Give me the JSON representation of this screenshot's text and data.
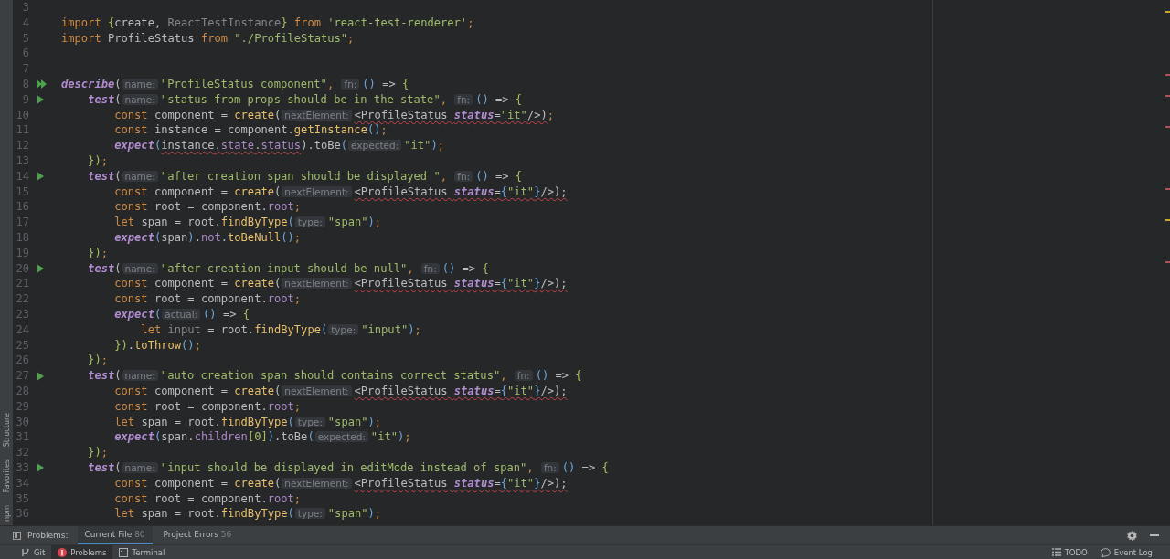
{
  "left_strip": [
    "Structure",
    "Favorites",
    "npm"
  ],
  "editor": {
    "lines": [
      {
        "number": "3",
        "kind": "plain"
      },
      {
        "number": "4",
        "kind": "plain",
        "tokens": [
          {
            "text": "import ",
            "kind": "kw"
          },
          {
            "text": "{",
            "kind": "brace"
          },
          {
            "text": "create, ",
            "kind": "plain"
          },
          {
            "text": "ReactTestInstance",
            "kind": "dim"
          },
          {
            "text": "}",
            "kind": "brace"
          },
          {
            "text": " from ",
            "kind": "kw"
          },
          {
            "text": "'react-test-renderer'",
            "kind": "str"
          },
          {
            "text": ";",
            "kind": "kw"
          }
        ]
      },
      {
        "number": "5",
        "kind": "plain",
        "tokens": [
          {
            "text": "import ",
            "kind": "kw"
          },
          {
            "text": "ProfileStatus",
            "kind": "plain"
          },
          {
            "text": " from ",
            "kind": "kw"
          },
          {
            "text": "\"./ProfileStatus\"",
            "kind": "str"
          },
          {
            "text": ";",
            "kind": "kw"
          }
        ]
      },
      {
        "number": "6",
        "kind": "plain"
      },
      {
        "number": "7",
        "kind": "plain"
      },
      {
        "number": "8",
        "kind": "suite",
        "tokens": [
          {
            "text": "describe",
            "kind": "test"
          },
          {
            "text": "(",
            "kind": "plain"
          },
          {
            "text": "name:",
            "kind": "hint"
          },
          {
            "text": "\"ProfileStatus component\"",
            "kind": "str"
          },
          {
            "text": ", ",
            "kind": "kw"
          },
          {
            "text": "fn:",
            "kind": "hint"
          },
          {
            "text": "()",
            "kind": "br"
          },
          {
            "text": " => ",
            "kind": "plain"
          },
          {
            "text": "{",
            "kind": "brace"
          }
        ]
      },
      {
        "number": "9",
        "kind": "test",
        "tokens": [
          {
            "text": "    test",
            "kind": "test"
          },
          {
            "text": "(",
            "kind": "plain"
          },
          {
            "text": "name:",
            "kind": "hint"
          },
          {
            "text": "\"status from props should be in the state\"",
            "kind": "str"
          },
          {
            "text": ", ",
            "kind": "kw"
          },
          {
            "text": "fn:",
            "kind": "hint"
          },
          {
            "text": "()",
            "kind": "br"
          },
          {
            "text": " => ",
            "kind": "plain"
          },
          {
            "text": "{",
            "kind": "brace"
          }
        ]
      },
      {
        "number": "10",
        "kind": "plain",
        "tokens": [
          {
            "text": "        const ",
            "kind": "kw"
          },
          {
            "text": "component = ",
            "kind": "plain"
          },
          {
            "text": "create",
            "kind": "fn"
          },
          {
            "text": "(",
            "kind": "plain"
          },
          {
            "text": "nextElement:",
            "kind": "hint"
          },
          {
            "text": "<ProfileStatus ",
            "kind": "plain-err"
          },
          {
            "text": "status",
            "kind": "attr-err"
          },
          {
            "text": "=",
            "kind": "plain-err"
          },
          {
            "text": "\"it\"",
            "kind": "str-err"
          },
          {
            "text": "/>)",
            "kind": "plain-err"
          },
          {
            "text": ";",
            "kind": "kw"
          }
        ]
      },
      {
        "number": "11",
        "kind": "plain",
        "tokens": [
          {
            "text": "        const ",
            "kind": "kw"
          },
          {
            "text": "instance = component.",
            "kind": "plain"
          },
          {
            "text": "getInstance",
            "kind": "fn"
          },
          {
            "text": "()",
            "kind": "br"
          },
          {
            "text": ";",
            "kind": "kw"
          }
        ]
      },
      {
        "number": "12",
        "kind": "plain",
        "tokens": [
          {
            "text": "        expect",
            "kind": "test"
          },
          {
            "text": "(",
            "kind": "br"
          },
          {
            "text": "instance",
            "kind": "plain-err"
          },
          {
            "text": ".",
            "kind": "plain-err"
          },
          {
            "text": "state",
            "kind": "prop-err"
          },
          {
            "text": ".",
            "kind": "plain-err"
          },
          {
            "text": "status",
            "kind": "prop-err"
          },
          {
            "text": ").toBe",
            "kind": "plain"
          },
          {
            "text": "(",
            "kind": "br"
          },
          {
            "text": "expected:",
            "kind": "hint"
          },
          {
            "text": "\"it\"",
            "kind": "str"
          },
          {
            "text": ")",
            "kind": "br"
          },
          {
            "text": ";",
            "kind": "kw"
          }
        ]
      },
      {
        "number": "13",
        "kind": "plain",
        "tokens": [
          {
            "text": "    })",
            "kind": "brace"
          },
          {
            "text": ";",
            "kind": "kw"
          }
        ]
      },
      {
        "number": "14",
        "kind": "test",
        "tokens": [
          {
            "text": "    test",
            "kind": "test"
          },
          {
            "text": "(",
            "kind": "plain"
          },
          {
            "text": "name:",
            "kind": "hint"
          },
          {
            "text": "\"after creation span should be displayed \"",
            "kind": "str"
          },
          {
            "text": ", ",
            "kind": "kw"
          },
          {
            "text": "fn:",
            "kind": "hint"
          },
          {
            "text": "()",
            "kind": "br"
          },
          {
            "text": " => ",
            "kind": "plain"
          },
          {
            "text": "{",
            "kind": "brace"
          }
        ]
      },
      {
        "number": "15",
        "kind": "plain",
        "tokens": [
          {
            "text": "        const ",
            "kind": "kw"
          },
          {
            "text": "component = ",
            "kind": "plain"
          },
          {
            "text": "create",
            "kind": "fn"
          },
          {
            "text": "(",
            "kind": "plain"
          },
          {
            "text": "nextElement:",
            "kind": "hint"
          },
          {
            "text": "<ProfileStatus ",
            "kind": "plain-err"
          },
          {
            "text": "status",
            "kind": "attr-err"
          },
          {
            "text": "=",
            "kind": "plain-err"
          },
          {
            "text": "{",
            "kind": "br-err"
          },
          {
            "text": "\"it\"",
            "kind": "str-err"
          },
          {
            "text": "}",
            "kind": "br-err"
          },
          {
            "text": "/>);",
            "kind": "plain-err"
          }
        ]
      },
      {
        "number": "16",
        "kind": "plain",
        "tokens": [
          {
            "text": "        const ",
            "kind": "kw"
          },
          {
            "text": "root = component.",
            "kind": "plain"
          },
          {
            "text": "root",
            "kind": "prop"
          },
          {
            "text": ";",
            "kind": "kw"
          }
        ]
      },
      {
        "number": "17",
        "kind": "plain",
        "tokens": [
          {
            "text": "        let ",
            "kind": "kw"
          },
          {
            "text": "span = root.",
            "kind": "plain"
          },
          {
            "text": "findByType",
            "kind": "fn"
          },
          {
            "text": "(",
            "kind": "br"
          },
          {
            "text": "type:",
            "kind": "hint"
          },
          {
            "text": "\"span\"",
            "kind": "str"
          },
          {
            "text": ")",
            "kind": "br"
          },
          {
            "text": ";",
            "kind": "kw"
          }
        ]
      },
      {
        "number": "18",
        "kind": "plain",
        "tokens": [
          {
            "text": "        expect",
            "kind": "test"
          },
          {
            "text": "(",
            "kind": "br"
          },
          {
            "text": "span",
            "kind": "plain"
          },
          {
            "text": ")",
            "kind": "br"
          },
          {
            "text": ".",
            "kind": "plain"
          },
          {
            "text": "not",
            "kind": "prop"
          },
          {
            "text": ".",
            "kind": "plain"
          },
          {
            "text": "toBeNull",
            "kind": "fn"
          },
          {
            "text": "()",
            "kind": "br"
          },
          {
            "text": ";",
            "kind": "kw"
          }
        ]
      },
      {
        "number": "19",
        "kind": "plain",
        "tokens": [
          {
            "text": "    })",
            "kind": "brace"
          },
          {
            "text": ";",
            "kind": "kw"
          }
        ]
      },
      {
        "number": "20",
        "kind": "test",
        "tokens": [
          {
            "text": "    test",
            "kind": "test"
          },
          {
            "text": "(",
            "kind": "plain"
          },
          {
            "text": "name:",
            "kind": "hint"
          },
          {
            "text": "\"after creation input should be null\"",
            "kind": "str"
          },
          {
            "text": ", ",
            "kind": "kw"
          },
          {
            "text": "fn:",
            "kind": "hint"
          },
          {
            "text": "()",
            "kind": "br"
          },
          {
            "text": " => ",
            "kind": "plain"
          },
          {
            "text": "{",
            "kind": "brace"
          }
        ]
      },
      {
        "number": "21",
        "kind": "plain",
        "tokens": [
          {
            "text": "        const ",
            "kind": "kw"
          },
          {
            "text": "component = ",
            "kind": "plain"
          },
          {
            "text": "create",
            "kind": "fn"
          },
          {
            "text": "(",
            "kind": "plain"
          },
          {
            "text": "nextElement:",
            "kind": "hint"
          },
          {
            "text": "<ProfileStatus ",
            "kind": "plain-err"
          },
          {
            "text": "status",
            "kind": "attr-err"
          },
          {
            "text": "=",
            "kind": "plain-err"
          },
          {
            "text": "{",
            "kind": "br-err"
          },
          {
            "text": "\"it\"",
            "kind": "str-err"
          },
          {
            "text": "}",
            "kind": "br-err"
          },
          {
            "text": "/>);",
            "kind": "plain-err"
          }
        ]
      },
      {
        "number": "22",
        "kind": "plain",
        "tokens": [
          {
            "text": "        const ",
            "kind": "kw"
          },
          {
            "text": "root = component.",
            "kind": "plain"
          },
          {
            "text": "root",
            "kind": "prop"
          },
          {
            "text": ";",
            "kind": "kw"
          }
        ]
      },
      {
        "number": "23",
        "kind": "plain",
        "tokens": [
          {
            "text": "        expect",
            "kind": "test"
          },
          {
            "text": "(",
            "kind": "br"
          },
          {
            "text": "actual:",
            "kind": "hint"
          },
          {
            "text": "()",
            "kind": "br"
          },
          {
            "text": " => ",
            "kind": "plain"
          },
          {
            "text": "{",
            "kind": "brace"
          }
        ]
      },
      {
        "number": "24",
        "kind": "plain",
        "tokens": [
          {
            "text": "            let ",
            "kind": "kw"
          },
          {
            "text": "input",
            "kind": "dim"
          },
          {
            "text": " = root.",
            "kind": "plain"
          },
          {
            "text": "findByType",
            "kind": "fn"
          },
          {
            "text": "(",
            "kind": "br"
          },
          {
            "text": "type:",
            "kind": "hint"
          },
          {
            "text": "\"input\"",
            "kind": "str"
          },
          {
            "text": ")",
            "kind": "br"
          },
          {
            "text": ";",
            "kind": "kw"
          }
        ]
      },
      {
        "number": "25",
        "kind": "plain",
        "tokens": [
          {
            "text": "        })",
            "kind": "brace"
          },
          {
            "text": ".",
            "kind": "plain"
          },
          {
            "text": "toThrow",
            "kind": "fn"
          },
          {
            "text": "()",
            "kind": "br"
          },
          {
            "text": ";",
            "kind": "kw"
          }
        ]
      },
      {
        "number": "26",
        "kind": "plain",
        "tokens": [
          {
            "text": "    })",
            "kind": "brace"
          },
          {
            "text": ";",
            "kind": "kw"
          }
        ]
      },
      {
        "number": "27",
        "kind": "test",
        "tokens": [
          {
            "text": "    test",
            "kind": "test"
          },
          {
            "text": "(",
            "kind": "plain"
          },
          {
            "text": "name:",
            "kind": "hint"
          },
          {
            "text": "\"auto creation span should contains correct status\"",
            "kind": "str"
          },
          {
            "text": ", ",
            "kind": "kw"
          },
          {
            "text": "fn:",
            "kind": "hint"
          },
          {
            "text": "()",
            "kind": "br"
          },
          {
            "text": " => ",
            "kind": "plain"
          },
          {
            "text": "{",
            "kind": "brace"
          }
        ]
      },
      {
        "number": "28",
        "kind": "plain",
        "tokens": [
          {
            "text": "        const ",
            "kind": "kw"
          },
          {
            "text": "component = ",
            "kind": "plain"
          },
          {
            "text": "create",
            "kind": "fn"
          },
          {
            "text": "(",
            "kind": "plain"
          },
          {
            "text": "nextElement:",
            "kind": "hint"
          },
          {
            "text": "<ProfileStatus ",
            "kind": "plain-err"
          },
          {
            "text": "status",
            "kind": "attr-err"
          },
          {
            "text": "=",
            "kind": "plain-err"
          },
          {
            "text": "{",
            "kind": "br-err"
          },
          {
            "text": "\"it\"",
            "kind": "str-err"
          },
          {
            "text": "}",
            "kind": "br-err"
          },
          {
            "text": "/>);",
            "kind": "plain-err"
          }
        ]
      },
      {
        "number": "29",
        "kind": "plain",
        "tokens": [
          {
            "text": "        const ",
            "kind": "kw"
          },
          {
            "text": "root = component.",
            "kind": "plain"
          },
          {
            "text": "root",
            "kind": "prop"
          },
          {
            "text": ";",
            "kind": "kw"
          }
        ]
      },
      {
        "number": "30",
        "kind": "plain",
        "tokens": [
          {
            "text": "        let ",
            "kind": "kw"
          },
          {
            "text": "span = root.",
            "kind": "plain"
          },
          {
            "text": "findByType",
            "kind": "fn"
          },
          {
            "text": "(",
            "kind": "br"
          },
          {
            "text": "type:",
            "kind": "hint"
          },
          {
            "text": "\"span\"",
            "kind": "str"
          },
          {
            "text": ")",
            "kind": "br"
          },
          {
            "text": ";",
            "kind": "kw"
          }
        ]
      },
      {
        "number": "31",
        "kind": "plain",
        "tokens": [
          {
            "text": "        expect",
            "kind": "test"
          },
          {
            "text": "(",
            "kind": "br"
          },
          {
            "text": "span.",
            "kind": "plain"
          },
          {
            "text": "children",
            "kind": "prop"
          },
          {
            "text": "[0]",
            "kind": "brace"
          },
          {
            "text": ")",
            "kind": "br"
          },
          {
            "text": ".toBe",
            "kind": "plain"
          },
          {
            "text": "(",
            "kind": "br"
          },
          {
            "text": "expected:",
            "kind": "hint"
          },
          {
            "text": "\"it\"",
            "kind": "str"
          },
          {
            "text": ")",
            "kind": "br"
          },
          {
            "text": ";",
            "kind": "kw"
          }
        ]
      },
      {
        "number": "32",
        "kind": "plain",
        "tokens": [
          {
            "text": "    })",
            "kind": "brace"
          },
          {
            "text": ";",
            "kind": "kw"
          }
        ]
      },
      {
        "number": "33",
        "kind": "test",
        "tokens": [
          {
            "text": "    test",
            "kind": "test"
          },
          {
            "text": "(",
            "kind": "plain"
          },
          {
            "text": "name:",
            "kind": "hint"
          },
          {
            "text": "\"input should be displayed in editMode instead of span\"",
            "kind": "str"
          },
          {
            "text": ", ",
            "kind": "kw"
          },
          {
            "text": "fn:",
            "kind": "hint"
          },
          {
            "text": "()",
            "kind": "br"
          },
          {
            "text": " => ",
            "kind": "plain"
          },
          {
            "text": "{",
            "kind": "brace"
          }
        ]
      },
      {
        "number": "34",
        "kind": "plain",
        "tokens": [
          {
            "text": "        const ",
            "kind": "kw"
          },
          {
            "text": "component = ",
            "kind": "plain"
          },
          {
            "text": "create",
            "kind": "fn"
          },
          {
            "text": "(",
            "kind": "plain"
          },
          {
            "text": "nextElement:",
            "kind": "hint"
          },
          {
            "text": "<ProfileStatus ",
            "kind": "plain-err"
          },
          {
            "text": "status",
            "kind": "attr-err"
          },
          {
            "text": "=",
            "kind": "plain-err"
          },
          {
            "text": "{",
            "kind": "br-err"
          },
          {
            "text": "\"it\"",
            "kind": "str-err"
          },
          {
            "text": "}",
            "kind": "br-err"
          },
          {
            "text": "/>);",
            "kind": "plain-err"
          }
        ]
      },
      {
        "number": "35",
        "kind": "plain",
        "tokens": [
          {
            "text": "        const ",
            "kind": "kw"
          },
          {
            "text": "root = component.",
            "kind": "plain"
          },
          {
            "text": "root",
            "kind": "prop"
          },
          {
            "text": ";",
            "kind": "kw"
          }
        ]
      },
      {
        "number": "36",
        "kind": "plain",
        "tokens": [
          {
            "text": "        let ",
            "kind": "kw"
          },
          {
            "text": "span = root.",
            "kind": "plain"
          },
          {
            "text": "findByType",
            "kind": "fn"
          },
          {
            "text": "(",
            "kind": "br"
          },
          {
            "text": "type:",
            "kind": "hint"
          },
          {
            "text": "\"span\"",
            "kind": "str"
          },
          {
            "text": ")",
            "kind": "br"
          },
          {
            "text": ";",
            "kind": "kw"
          }
        ]
      }
    ]
  },
  "problems_panel": {
    "label": "Problems:",
    "tabs": [
      {
        "label": "Current File",
        "count": "80",
        "selected": true
      },
      {
        "label": "Project Errors",
        "count": "56",
        "selected": false
      }
    ]
  },
  "status_bar": {
    "tool_tabs": [
      {
        "label": "Git",
        "selected": false
      },
      {
        "label": "Problems",
        "selected": true
      },
      {
        "label": "Terminal",
        "selected": false
      }
    ],
    "right": [
      "TODO",
      "Event Log"
    ]
  }
}
